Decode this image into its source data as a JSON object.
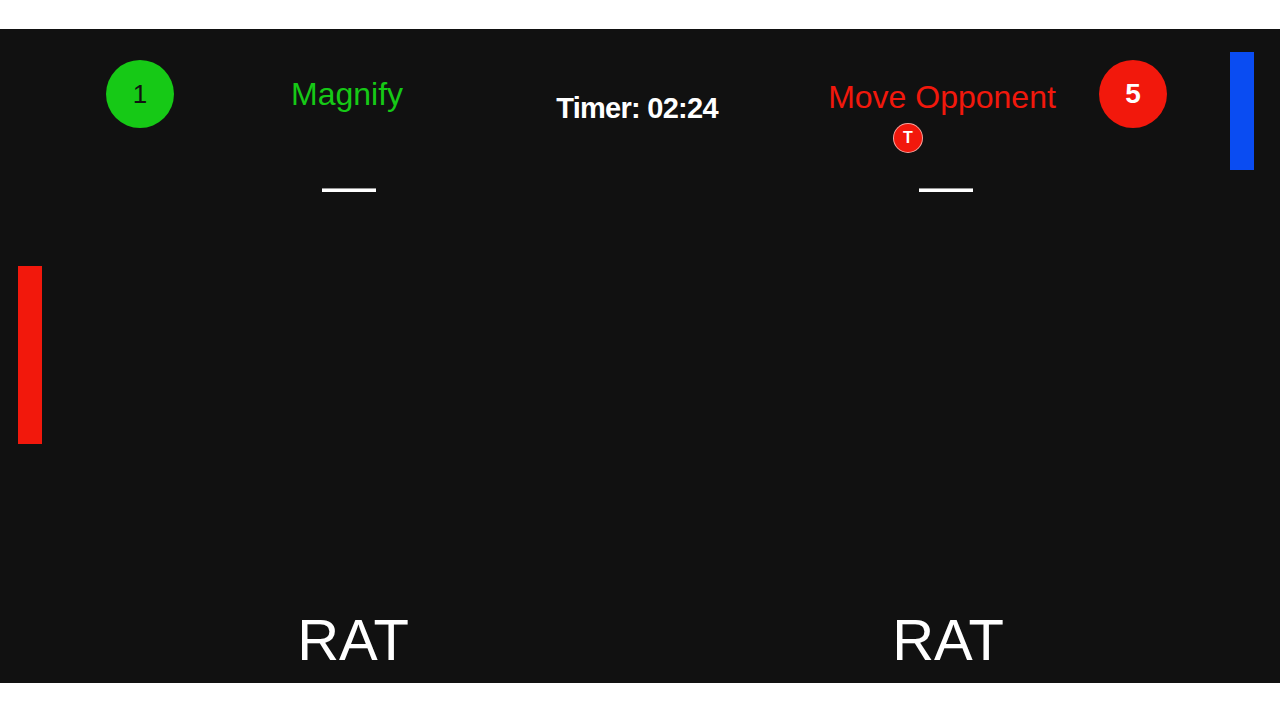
{
  "timer": "Timer: 02:24",
  "players": [
    {
      "score": "1",
      "power": "Magnify",
      "color": "#16c916",
      "dash": "—",
      "word": "RAT",
      "badge": null
    },
    {
      "score": "5",
      "power": "Move Opponent",
      "color": "#f2180c",
      "dash": "—",
      "word": "RAT",
      "badge": "T"
    }
  ],
  "paddles": [
    {
      "side": "left",
      "color": "#f2180c"
    },
    {
      "side": "right",
      "color": "#0a4cf2"
    }
  ]
}
